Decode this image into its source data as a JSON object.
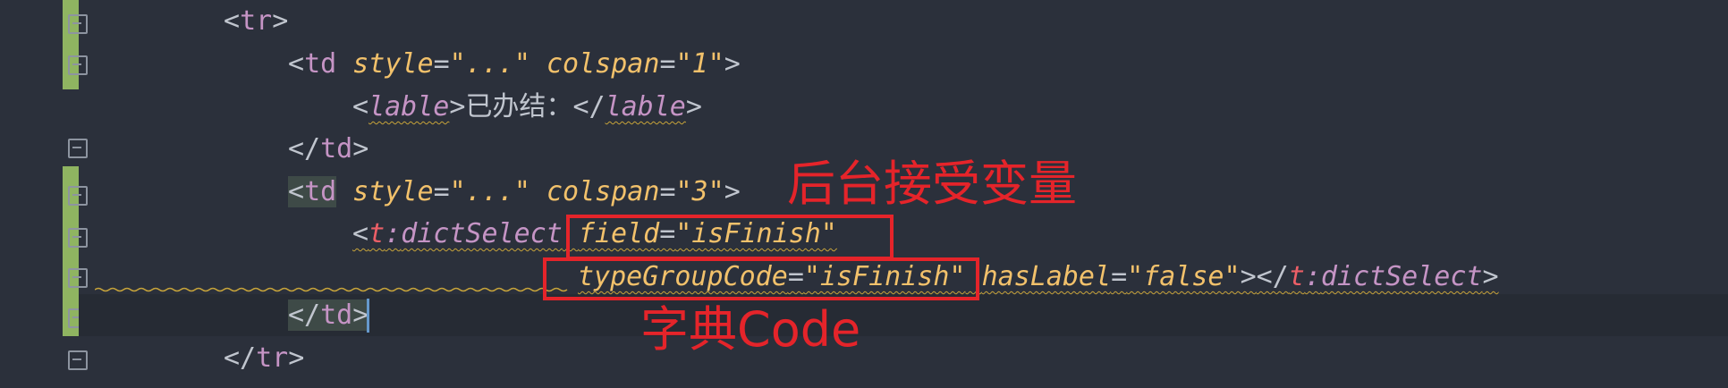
{
  "editor": {
    "lines": [
      {
        "lt": "<",
        "name": "tr",
        "gt": ">"
      },
      {
        "lt": "<",
        "name": "td",
        "attr1": "style",
        "eq1": "=",
        "val1": "\"...\"",
        "attr2": "colspan",
        "eq2": "=",
        "val2": "\"1\"",
        "gt": ">"
      },
      {
        "lt": "<",
        "name": "lable",
        "gt": ">",
        "text": "已办结：",
        "close_lt": "</",
        "close_name": "lable",
        "close_gt": ">"
      },
      {
        "lt": "</",
        "name": "td",
        "gt": ">"
      },
      {
        "lt": "<",
        "name": "td",
        "attr1": "style",
        "eq1": "=",
        "val1": "\"...\"",
        "attr2": "colspan",
        "eq2": "=",
        "val2": "\"3\"",
        "gt": ">"
      },
      {
        "lt": "<",
        "ns": "t",
        "colon": ":",
        "name": "dictSelect",
        "attr1": "field",
        "eq1": "=",
        "val1": "\"isFinish\""
      },
      {
        "attr1": "typeGroupCode",
        "eq1": "=",
        "val1": "\"isFinish\"",
        "attr2": "hasLabel",
        "eq2": "=",
        "val2": "\"false\"",
        "gt": ">",
        "close_lt": "</",
        "close_ns": "t",
        "close_colon": ":",
        "close_name": "dictSelect",
        "close_gt": ">"
      },
      {
        "lt": "</",
        "name": "td",
        "gt": ">"
      },
      {
        "lt": "</",
        "name": "tr",
        "gt": ">"
      }
    ]
  },
  "annotations": {
    "backend_var": "后台接受变量",
    "dict_code": "字典Code"
  },
  "colors": {
    "background": "#2b303b",
    "tag": "#c594c5",
    "attribute": "#f2c16b",
    "annotation_red": "#e5242a",
    "vcs_bar": "#8fb461"
  }
}
